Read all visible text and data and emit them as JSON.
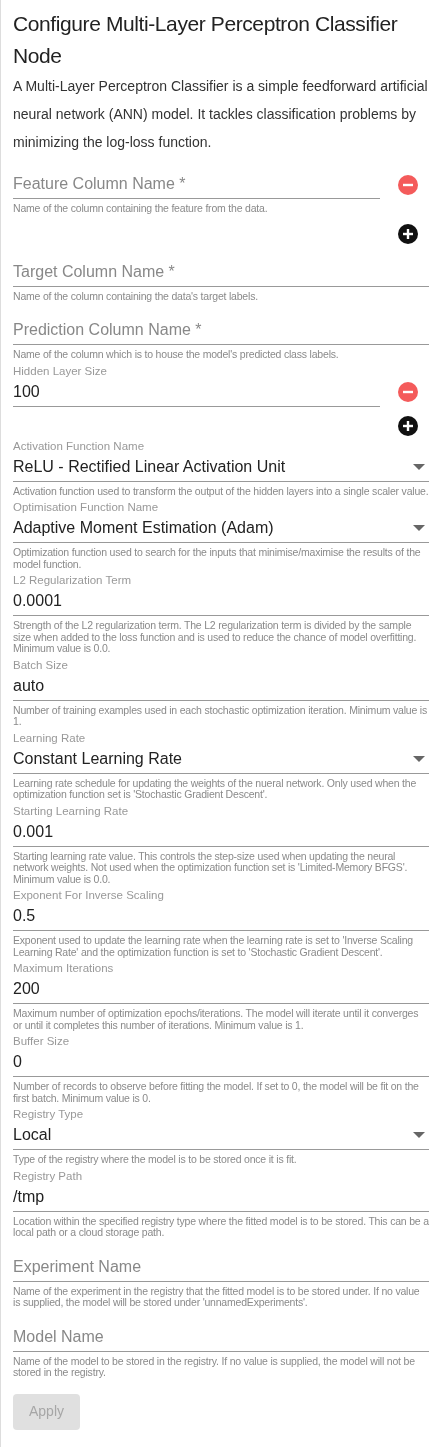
{
  "title": "Configure Multi-Layer Perceptron Classifier Node",
  "description": "A Multi-Layer Perceptron Classifier is a simple feedforward artificial neural network (ANN) model. It tackles classification problems by minimizing the log-loss function.",
  "fields": [
    {
      "kind": "list",
      "placeholder": "Feature Column Name *",
      "helper": "Name of the column containing the feature from the data."
    },
    {
      "kind": "text",
      "placeholder": "Target Column Name *",
      "helper": "Name of the column containing the data's target labels."
    },
    {
      "kind": "text",
      "placeholder": "Prediction Column Name *",
      "helper": "Name of the column which is to house the model's predicted class labels."
    },
    {
      "kind": "list",
      "label": "Hidden Layer Size",
      "value": "100"
    },
    {
      "kind": "select",
      "label": "Activation Function Name",
      "value": "ReLU - Rectified Linear Activation Unit",
      "helper": "Activation function used to transform the output of the hidden layers into a single scaler value."
    },
    {
      "kind": "select",
      "label": "Optimisation Function Name",
      "value": "Adaptive Moment Estimation (Adam)",
      "helper": "Optimization function used to search for the inputs that minimise/maximise the results of the model function."
    },
    {
      "kind": "text",
      "label": "L2 Regularization Term",
      "value": "0.0001",
      "helper": "Strength of the L2 regularization term. The L2 regularization term is divided by the sample size when added to the loss function and is used to reduce the chance of model overfitting. Minimum value is 0.0."
    },
    {
      "kind": "text",
      "label": "Batch Size",
      "value": "auto",
      "helper": "Number of training examples used in each stochastic optimization iteration. Minimum value is 1."
    },
    {
      "kind": "select",
      "label": "Learning Rate",
      "value": "Constant Learning Rate",
      "helper": "Learning rate schedule for updating the weights of the nueral network. Only used when the optimization function set is 'Stochastic Gradient Descent'."
    },
    {
      "kind": "text",
      "label": "Starting Learning Rate",
      "value": "0.001",
      "helper": "Starting learning rate value. This controls the step-size used when updating the neural network weights. Not used when the optimization function set is 'Limited-Memory BFGS'. Minimum value is 0.0."
    },
    {
      "kind": "text",
      "label": "Exponent For Inverse Scaling",
      "value": "0.5",
      "helper": "Exponent used to update the learning rate when the learning rate is set to 'Inverse Scaling Learning Rate' and the optimization function is set to 'Stochastic Gradient Descent'."
    },
    {
      "kind": "text",
      "label": "Maximum Iterations",
      "value": "200",
      "helper": "Maximum number of optimization epochs/iterations. The model will iterate until it converges or until it completes this number of iterations. Minimum value is 1."
    },
    {
      "kind": "text",
      "label": "Buffer Size",
      "value": "0",
      "helper": "Number of records to observe before fitting the model. If set to 0, the model will be fit on the first batch. Minimum value is 0."
    },
    {
      "kind": "select",
      "label": "Registry Type",
      "value": "Local",
      "helper": "Type of the registry where the model is to be stored once it is fit."
    },
    {
      "kind": "text",
      "label": "Registry Path",
      "value": "/tmp",
      "helper": "Location within the specified registry type where the fitted model is to be stored. This can be a local path or a cloud storage path."
    },
    {
      "kind": "text",
      "placeholder": "Experiment Name",
      "helper": "Name of the experiment in the registry that the fitted model is to be stored under. If no value is supplied, the model will be stored under 'unnamedExperiments'."
    },
    {
      "kind": "text",
      "placeholder": "Model Name",
      "helper": "Name of the model to be stored in the registry. If no value is supplied, the model will not be stored in the registry."
    }
  ],
  "apply_button": {
    "label": "Apply",
    "disabled": true
  }
}
